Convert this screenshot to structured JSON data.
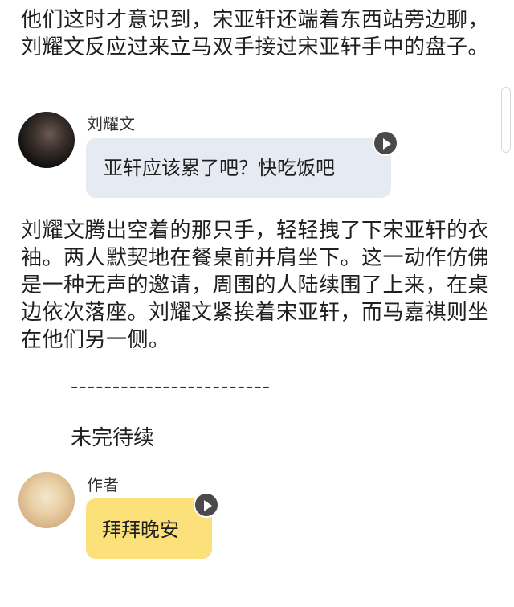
{
  "story": {
    "paragraph_1": "他们这时才意识到，宋亚轩还端着东西站旁边聊，刘耀文反应过来立马双手接过宋亚轩手中的盘子。",
    "paragraph_2": "刘耀文腾出空着的那只手，轻轻拽了下宋亚轩的衣袖。两人默契地在餐桌前并肩坐下。这一动作仿佛是一种无声的邀请，周围的人陆续围了上来，在桌边依次落座。刘耀文紧挨着宋亚轩，而马嘉祺则坐在他们另一侧。",
    "divider": "------------------------",
    "to_be_continued": "未完待续"
  },
  "messages": [
    {
      "sender": "刘耀文",
      "text": "亚轩应该累了吧？快吃饭吧",
      "bubble_color": "#e6eaf2",
      "avatar_icon": "person-photo-dark"
    },
    {
      "sender": "作者",
      "text": "拜拜晚安",
      "bubble_color": "#fce17a",
      "avatar_icon": "illustrated-avatar"
    }
  ],
  "icons": {
    "play": "play-icon"
  }
}
